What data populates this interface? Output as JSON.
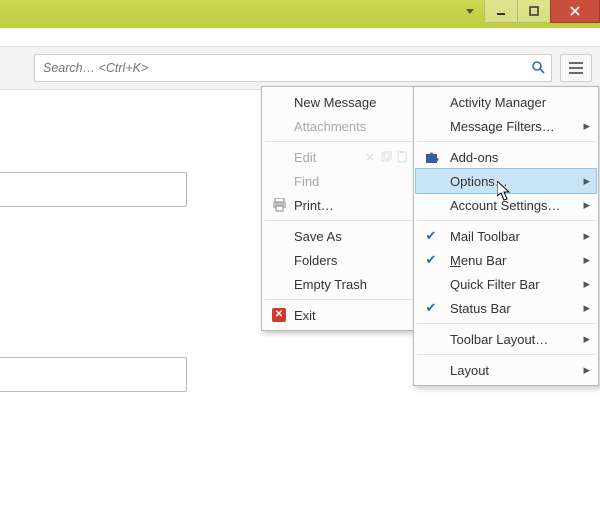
{
  "search": {
    "placeholder": "Search… <Ctrl+K>"
  },
  "menu1": {
    "new_message": "New Message",
    "attachments": "Attachments",
    "edit": "Edit",
    "find": "Find",
    "print": "Print…",
    "save_as": "Save As",
    "folders": "Folders",
    "empty_trash": "Empty Trash",
    "exit": "Exit"
  },
  "menu2": {
    "activity_manager": "Activity Manager",
    "message_filters": "Message Filters…",
    "addons": "Add-ons",
    "options": "Options…",
    "account_settings": "Account Settings…",
    "mail_toolbar": "Mail Toolbar",
    "menu_bar": "Menu Bar",
    "quick_filter_bar": "Quick Filter Bar",
    "status_bar": "Status Bar",
    "toolbar_layout": "Toolbar Layout…",
    "layout": "Layout"
  }
}
